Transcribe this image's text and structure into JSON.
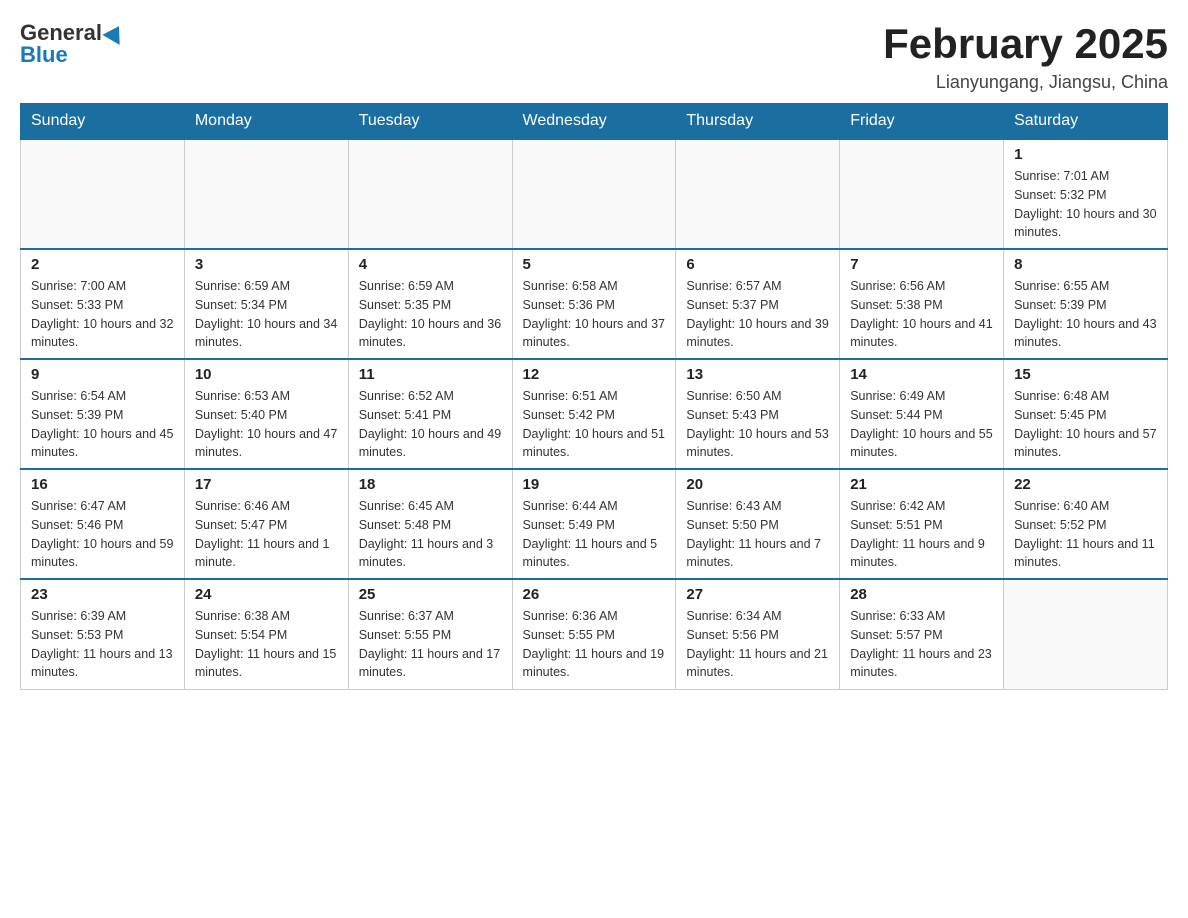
{
  "logo": {
    "general": "General",
    "blue": "Blue"
  },
  "title": "February 2025",
  "subtitle": "Lianyungang, Jiangsu, China",
  "days_of_week": [
    "Sunday",
    "Monday",
    "Tuesday",
    "Wednesday",
    "Thursday",
    "Friday",
    "Saturday"
  ],
  "weeks": [
    [
      {
        "day": "",
        "info": ""
      },
      {
        "day": "",
        "info": ""
      },
      {
        "day": "",
        "info": ""
      },
      {
        "day": "",
        "info": ""
      },
      {
        "day": "",
        "info": ""
      },
      {
        "day": "",
        "info": ""
      },
      {
        "day": "1",
        "info": "Sunrise: 7:01 AM\nSunset: 5:32 PM\nDaylight: 10 hours and 30 minutes."
      }
    ],
    [
      {
        "day": "2",
        "info": "Sunrise: 7:00 AM\nSunset: 5:33 PM\nDaylight: 10 hours and 32 minutes."
      },
      {
        "day": "3",
        "info": "Sunrise: 6:59 AM\nSunset: 5:34 PM\nDaylight: 10 hours and 34 minutes."
      },
      {
        "day": "4",
        "info": "Sunrise: 6:59 AM\nSunset: 5:35 PM\nDaylight: 10 hours and 36 minutes."
      },
      {
        "day": "5",
        "info": "Sunrise: 6:58 AM\nSunset: 5:36 PM\nDaylight: 10 hours and 37 minutes."
      },
      {
        "day": "6",
        "info": "Sunrise: 6:57 AM\nSunset: 5:37 PM\nDaylight: 10 hours and 39 minutes."
      },
      {
        "day": "7",
        "info": "Sunrise: 6:56 AM\nSunset: 5:38 PM\nDaylight: 10 hours and 41 minutes."
      },
      {
        "day": "8",
        "info": "Sunrise: 6:55 AM\nSunset: 5:39 PM\nDaylight: 10 hours and 43 minutes."
      }
    ],
    [
      {
        "day": "9",
        "info": "Sunrise: 6:54 AM\nSunset: 5:39 PM\nDaylight: 10 hours and 45 minutes."
      },
      {
        "day": "10",
        "info": "Sunrise: 6:53 AM\nSunset: 5:40 PM\nDaylight: 10 hours and 47 minutes."
      },
      {
        "day": "11",
        "info": "Sunrise: 6:52 AM\nSunset: 5:41 PM\nDaylight: 10 hours and 49 minutes."
      },
      {
        "day": "12",
        "info": "Sunrise: 6:51 AM\nSunset: 5:42 PM\nDaylight: 10 hours and 51 minutes."
      },
      {
        "day": "13",
        "info": "Sunrise: 6:50 AM\nSunset: 5:43 PM\nDaylight: 10 hours and 53 minutes."
      },
      {
        "day": "14",
        "info": "Sunrise: 6:49 AM\nSunset: 5:44 PM\nDaylight: 10 hours and 55 minutes."
      },
      {
        "day": "15",
        "info": "Sunrise: 6:48 AM\nSunset: 5:45 PM\nDaylight: 10 hours and 57 minutes."
      }
    ],
    [
      {
        "day": "16",
        "info": "Sunrise: 6:47 AM\nSunset: 5:46 PM\nDaylight: 10 hours and 59 minutes."
      },
      {
        "day": "17",
        "info": "Sunrise: 6:46 AM\nSunset: 5:47 PM\nDaylight: 11 hours and 1 minute."
      },
      {
        "day": "18",
        "info": "Sunrise: 6:45 AM\nSunset: 5:48 PM\nDaylight: 11 hours and 3 minutes."
      },
      {
        "day": "19",
        "info": "Sunrise: 6:44 AM\nSunset: 5:49 PM\nDaylight: 11 hours and 5 minutes."
      },
      {
        "day": "20",
        "info": "Sunrise: 6:43 AM\nSunset: 5:50 PM\nDaylight: 11 hours and 7 minutes."
      },
      {
        "day": "21",
        "info": "Sunrise: 6:42 AM\nSunset: 5:51 PM\nDaylight: 11 hours and 9 minutes."
      },
      {
        "day": "22",
        "info": "Sunrise: 6:40 AM\nSunset: 5:52 PM\nDaylight: 11 hours and 11 minutes."
      }
    ],
    [
      {
        "day": "23",
        "info": "Sunrise: 6:39 AM\nSunset: 5:53 PM\nDaylight: 11 hours and 13 minutes."
      },
      {
        "day": "24",
        "info": "Sunrise: 6:38 AM\nSunset: 5:54 PM\nDaylight: 11 hours and 15 minutes."
      },
      {
        "day": "25",
        "info": "Sunrise: 6:37 AM\nSunset: 5:55 PM\nDaylight: 11 hours and 17 minutes."
      },
      {
        "day": "26",
        "info": "Sunrise: 6:36 AM\nSunset: 5:55 PM\nDaylight: 11 hours and 19 minutes."
      },
      {
        "day": "27",
        "info": "Sunrise: 6:34 AM\nSunset: 5:56 PM\nDaylight: 11 hours and 21 minutes."
      },
      {
        "day": "28",
        "info": "Sunrise: 6:33 AM\nSunset: 5:57 PM\nDaylight: 11 hours and 23 minutes."
      },
      {
        "day": "",
        "info": ""
      }
    ]
  ]
}
